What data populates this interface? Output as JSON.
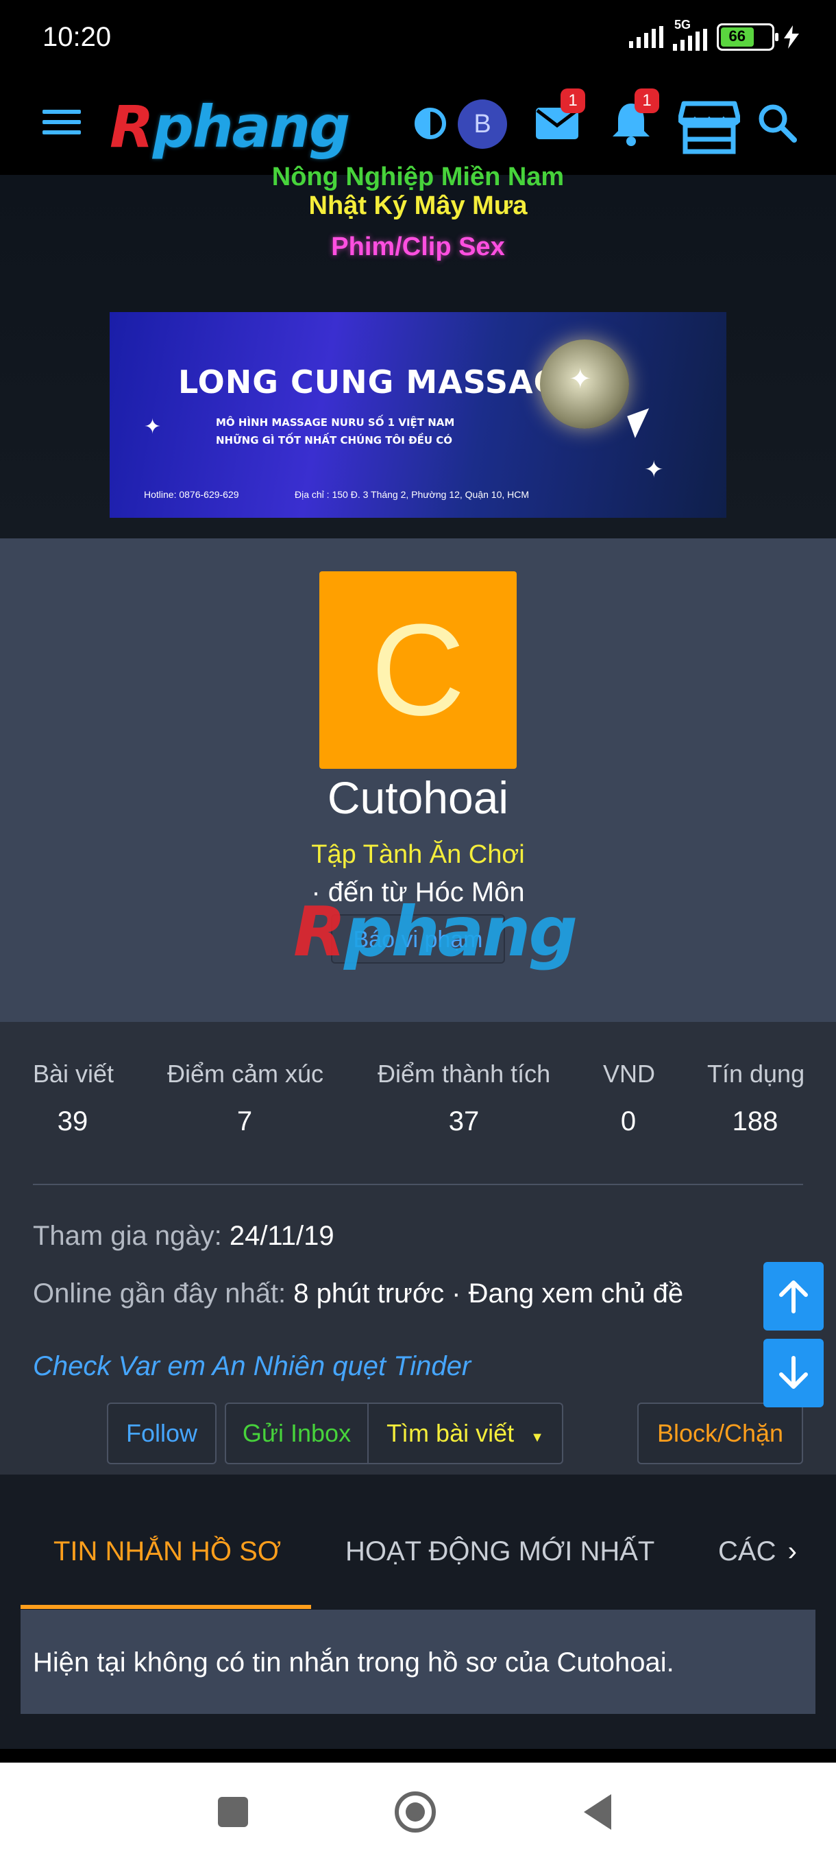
{
  "status_bar": {
    "time": "10:20",
    "network": "5G",
    "battery": "66"
  },
  "nav": {
    "logo_r": "R",
    "logo_rest": "phang",
    "avatar_initial": "B",
    "inbox_count": "1",
    "alerts_count": "1"
  },
  "menu": {
    "cut_item": "Nông Nghiệp Miền Nam",
    "item_1": "Nhật Ký Mây Mưa",
    "item_2": "Phim/Clip Sex"
  },
  "banner": {
    "title": "LONG CUNG MASSAGE",
    "line_1": "MÔ HÌNH MASSAGE NURU SỐ 1 VIỆT NAM",
    "line_2": "NHỮNG GÌ TỐT NHẤT CHÚNG TÔI ĐỀU CÓ",
    "hotline": "Hotline: 0876-629-629",
    "address": "Địa chỉ : 150 Đ. 3 Tháng 2, Phường 12, Quận 10, HCM"
  },
  "profile": {
    "avatar_letter": "C",
    "username": "Cutohoai",
    "user_title": "Tập Tành Ăn Chơi",
    "location": "· đến từ Hóc Môn",
    "report_label": "Báo vi phạm",
    "watermark_r": "R",
    "watermark_rest": "phang"
  },
  "stats": [
    {
      "label": "Bài viết",
      "value": "39"
    },
    {
      "label": "Điểm cảm xúc",
      "value": "7"
    },
    {
      "label": "Điểm thành tích",
      "value": "37"
    },
    {
      "label": "VND",
      "value": "0"
    },
    {
      "label": "Tín dụng",
      "value": "188"
    }
  ],
  "info": {
    "joined_label": "Tham gia ngày:",
    "joined_value": "24/11/19",
    "online_label": "Online gần đây nhất:",
    "online_value": "8 phút trước · Đang xem chủ đề",
    "activity_link": "Check Var em An Nhiên quẹt Tinder"
  },
  "actions": {
    "follow": "Follow",
    "inbox": "Gửi Inbox",
    "find_posts": "Tìm bài viết",
    "block": "Block/Chặn"
  },
  "tabs": [
    {
      "label": "TIN NHẮN HỒ SƠ"
    },
    {
      "label": "HOẠT ĐỘNG MỚI NHẤT"
    },
    {
      "label": "CÁC"
    }
  ],
  "empty_message": "Hiện tại không có tin nhắn trong hồ sơ của Cutohoai.",
  "colors": {
    "accent_blue": "#46a6ff",
    "accent_orange": "#ff9f1c",
    "avatar_orange": "#ffa000",
    "follow": "#46a6ff",
    "inbox": "#47d33b",
    "find": "#f5ee3b",
    "block": "#ff9f1c"
  }
}
